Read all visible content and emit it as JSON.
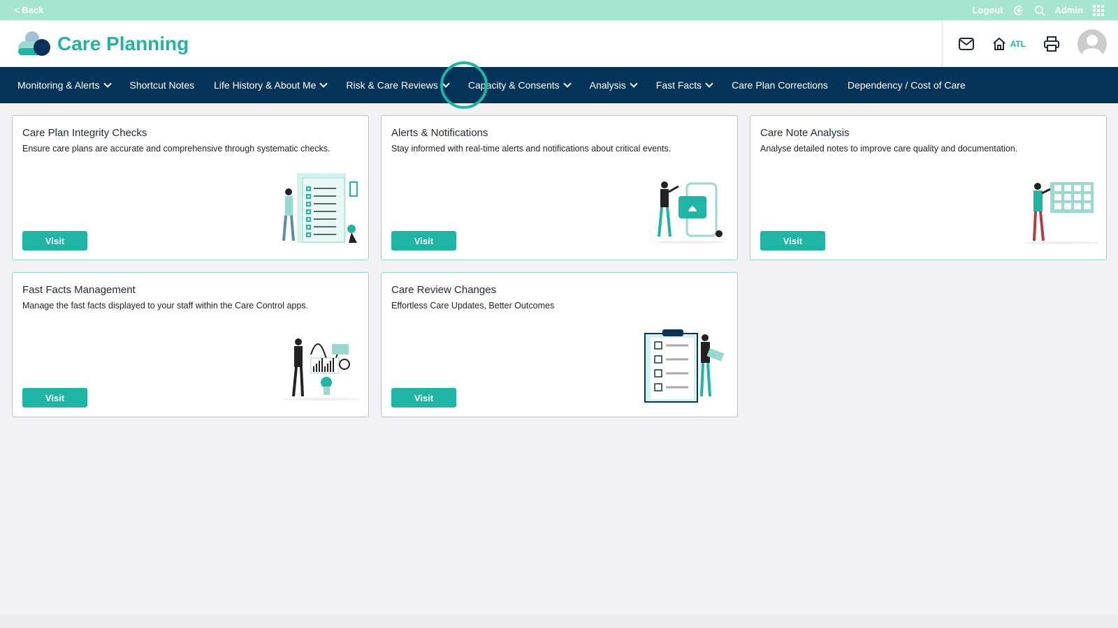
{
  "topbar": {
    "back": "< Back",
    "logout": "Logout",
    "admin": "Admin"
  },
  "header": {
    "title": "Care Planning",
    "location": "ATL"
  },
  "nav": [
    {
      "label": "Monitoring & Alerts",
      "dropdown": true
    },
    {
      "label": "Shortcut Notes",
      "dropdown": false
    },
    {
      "label": "Life History & About Me",
      "dropdown": true
    },
    {
      "label": "Risk & Care Reviews",
      "dropdown": true
    },
    {
      "label": "Capacity & Consents",
      "dropdown": true
    },
    {
      "label": "Analysis",
      "dropdown": true
    },
    {
      "label": "Fast Facts",
      "dropdown": true
    },
    {
      "label": "Care Plan Corrections",
      "dropdown": false
    },
    {
      "label": "Dependency / Cost of Care",
      "dropdown": false
    }
  ],
  "cards": [
    {
      "title": "Care Plan Integrity Checks",
      "desc": "Ensure care plans are accurate and comprehensive through systematic checks.",
      "button": "Visit"
    },
    {
      "title": "Alerts & Notifications",
      "desc": "Stay informed with real-time alerts and notifications about critical events.",
      "button": "Visit"
    },
    {
      "title": "Care Note Analysis",
      "desc": "Analyse detailed notes to improve care quality and documentation.",
      "button": "Visit"
    },
    {
      "title": "Fast Facts Management",
      "desc": "Manage the fast facts displayed to your staff within the Care Control apps.",
      "button": "Visit"
    },
    {
      "title": "Care Review Changes",
      "desc": "Effortless Care Updates, Better Outcomes",
      "button": "Visit"
    }
  ],
  "colors": {
    "accent": "#1fb5a5",
    "nav": "#04345a",
    "topbar": "#a6e6d0"
  }
}
